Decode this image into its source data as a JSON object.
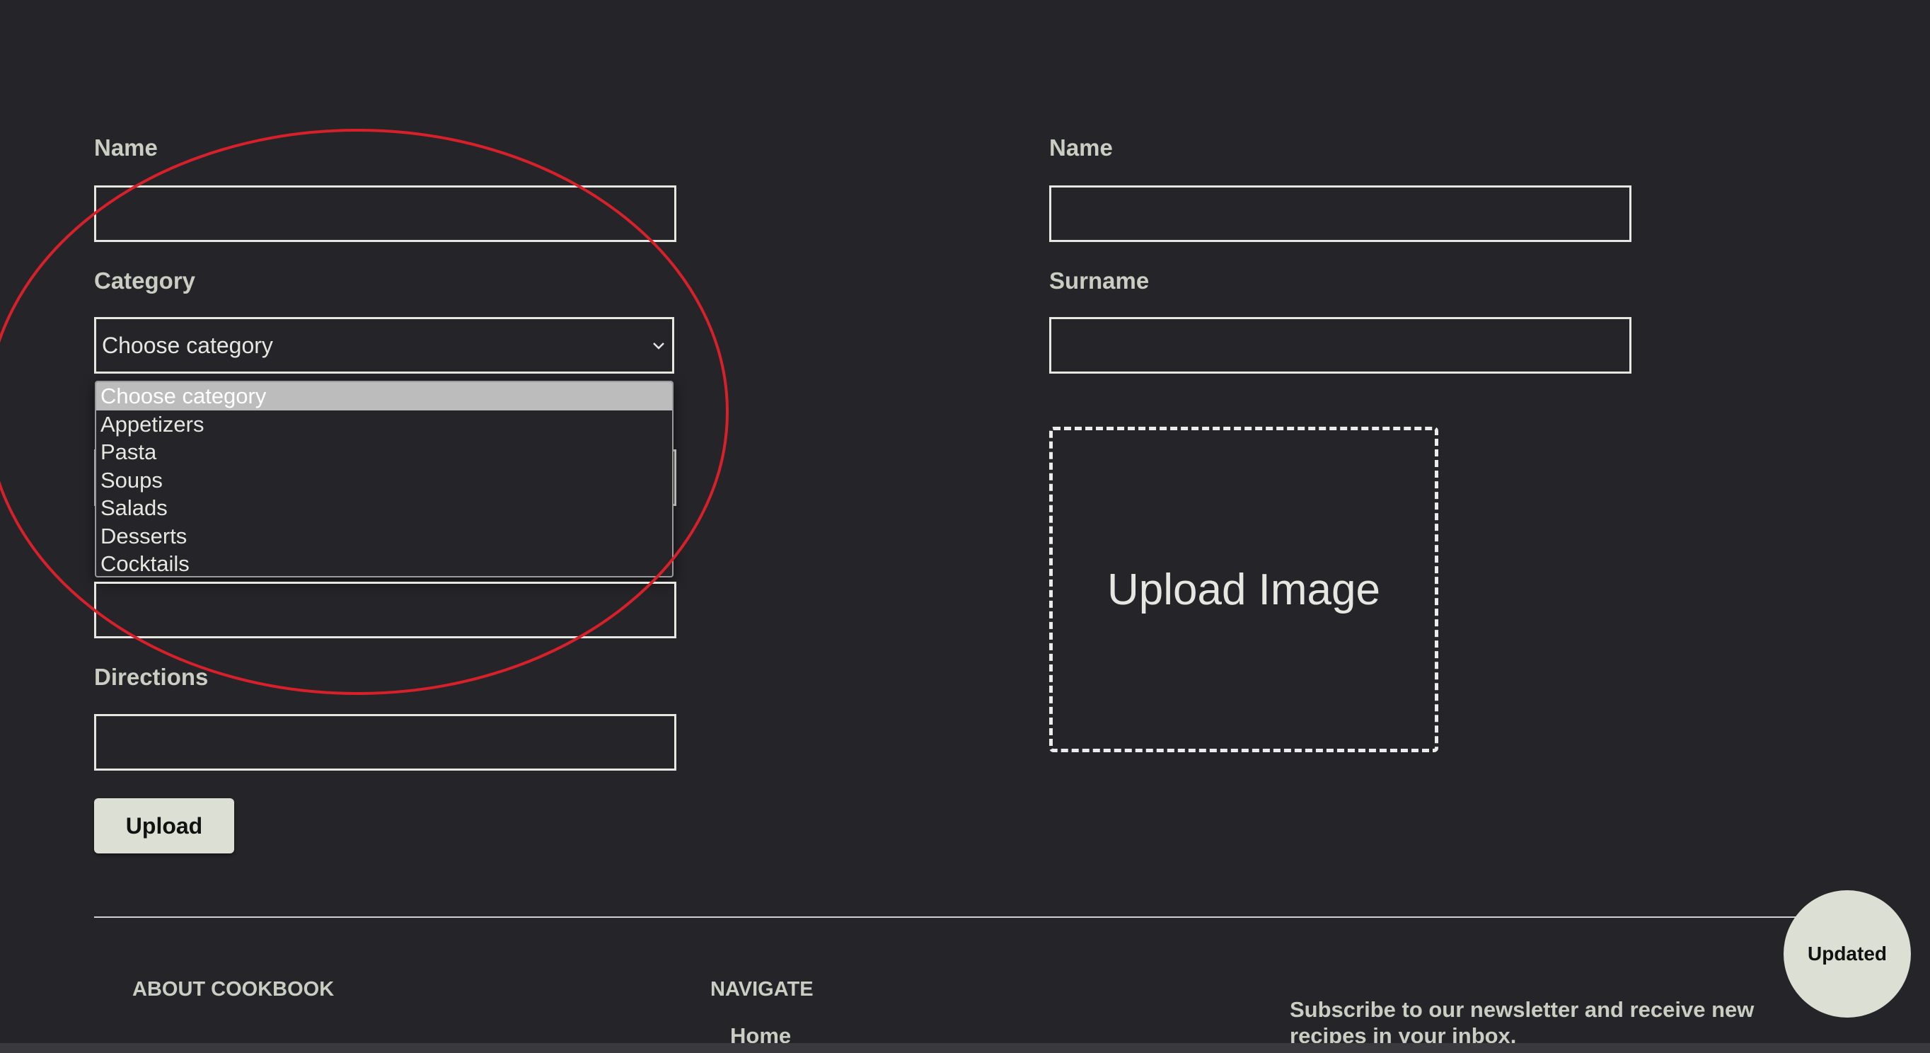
{
  "form": {
    "name_label": "Name",
    "name_value": "",
    "category_label": "Category",
    "category_selected": "Choose category",
    "category_options": [
      "Choose category",
      "Appetizers",
      "Pasta",
      "Soups",
      "Salads",
      "Desserts",
      "Cocktails"
    ],
    "ingredients_value": "",
    "directions_label": "Directions",
    "directions_value": "",
    "upload_button": "Upload"
  },
  "author": {
    "name_label": "Name",
    "name_value": "",
    "surname_label": "Surname",
    "surname_value": "",
    "upload_image_label": "Upload Image"
  },
  "footer": {
    "about_heading": "ABOUT COOKBOOK",
    "navigate_heading": "NAVIGATE",
    "nav_home": "Home",
    "newsletter_text": "Subscribe to our newsletter and receive new recipes in your inbox."
  },
  "badge": {
    "label": "Updated"
  },
  "colors": {
    "background": "#252429",
    "label_text": "#c9cdc2",
    "input_border": "#e6e7e1",
    "button_bg": "#dcdfd3",
    "annotation_ellipse": "#d8202a",
    "selected_option_bg": "#bcbcbc"
  },
  "icons": {
    "select_chevron": "chevron-down-icon"
  }
}
